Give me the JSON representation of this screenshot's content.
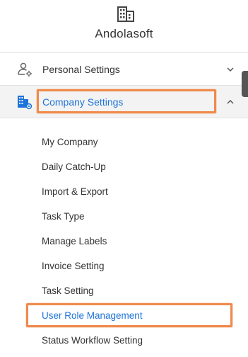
{
  "header": {
    "logo_icon": "building-icon",
    "brand": "Andolasoft"
  },
  "menu": {
    "personal": {
      "icon": "user-settings-icon",
      "label": "Personal Settings",
      "chevron": "chevron-down-icon"
    },
    "company": {
      "icon": "building-settings-icon",
      "label": "Company Settings",
      "chevron": "chevron-up-icon"
    }
  },
  "submenu": [
    {
      "label": "My Company"
    },
    {
      "label": "Daily Catch-Up"
    },
    {
      "label": "Import & Export"
    },
    {
      "label": "Task Type"
    },
    {
      "label": "Manage Labels"
    },
    {
      "label": "Invoice Setting"
    },
    {
      "label": "Task Setting"
    },
    {
      "label": "User Role Management",
      "active": true
    },
    {
      "label": "Status Workflow Setting"
    }
  ],
  "colors": {
    "accent": "#1e73d9",
    "highlight": "#f08a4b",
    "active_row_bg": "#f3f3f3"
  }
}
